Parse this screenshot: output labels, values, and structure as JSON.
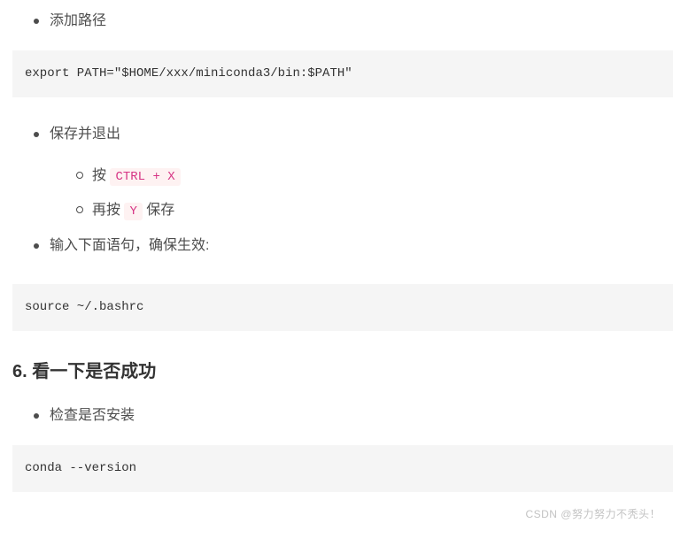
{
  "bullets": {
    "add_path": "添加路径",
    "save_exit": "保存并退出",
    "press_prefix": "按 ",
    "ctrl_x": "CTRL + X",
    "then_press_prefix": "再按 ",
    "y_key": "Y",
    "then_press_suffix": " 保存",
    "input_statement": "输入下面语句，确保生效:",
    "check_install": "检查是否安装"
  },
  "codeblocks": {
    "export_path": "export PATH=\"$HOME/xxx/miniconda3/bin:$PATH\"",
    "source_bashrc": "source ~/.bashrc",
    "conda_version": "conda --version"
  },
  "heading": {
    "h6": "6. 看一下是否成功"
  },
  "watermark": "CSDN @努力努力不秃头！"
}
